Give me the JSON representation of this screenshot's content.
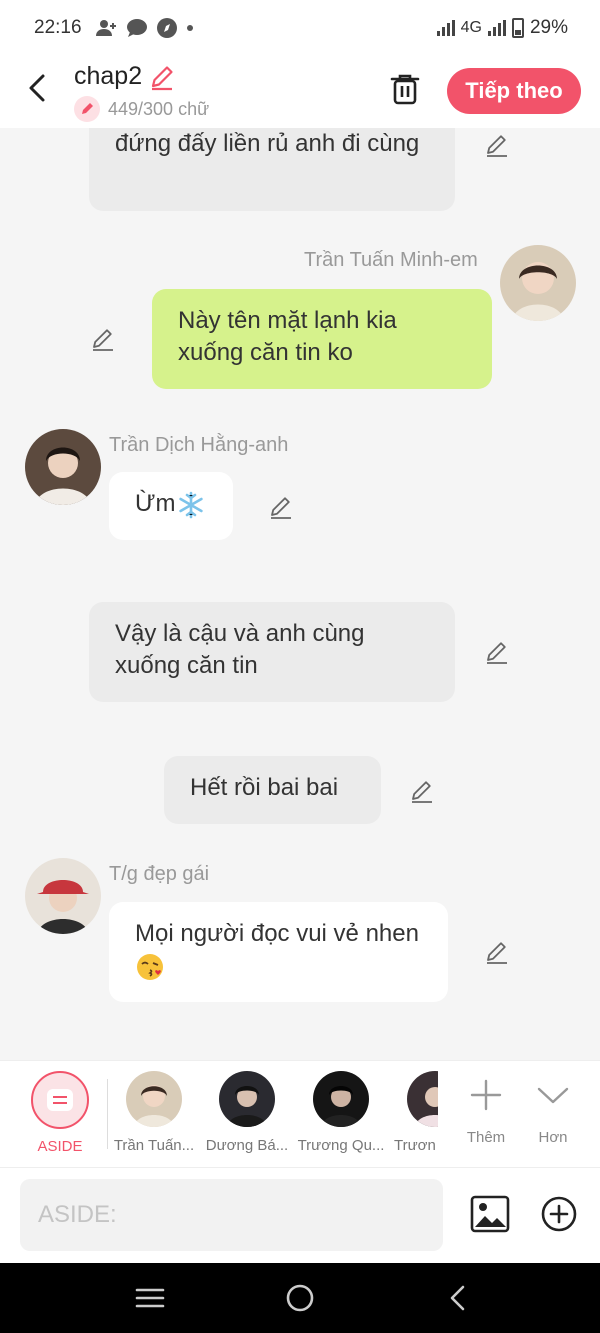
{
  "status": {
    "time": "22:16",
    "network": "4G",
    "battery": "29%"
  },
  "header": {
    "title": "chap2",
    "word_count": "449/300 chữ",
    "next_label": "Tiếp theo"
  },
  "messages": [
    {
      "type": "narration",
      "text": "đứng đấy liền rủ anh đi cùng"
    },
    {
      "type": "right",
      "sender": "Trần Tuấn Minh-em",
      "text": "Này tên mặt lạnh kia xuống căn tin ko"
    },
    {
      "type": "left",
      "sender": "Trần Dịch Hằng-anh",
      "text": "Ừm",
      "emoji": "snowflake"
    },
    {
      "type": "narration",
      "text": "Vậy là cậu và anh cùng xuống căn tin"
    },
    {
      "type": "narration",
      "text": "Hết rồi bai bai"
    },
    {
      "type": "left",
      "sender": "T/g đẹp gái",
      "text": "Mọi người đọc vui vẻ nhen",
      "emoji": "kissing-face"
    }
  ],
  "characters": {
    "aside_label": "ASIDE",
    "items": [
      {
        "name": "Trần Tuấn..."
      },
      {
        "name": "Dương Bá..."
      },
      {
        "name": "Trương Qu..."
      },
      {
        "name": "Trươn"
      }
    ],
    "more_label": "Thêm",
    "expand_label": "Hơn"
  },
  "composer": {
    "placeholder": "ASIDE:"
  },
  "colors": {
    "accent": "#f2536a",
    "bubble_green": "#d6f28c",
    "bubble_grey": "#ebebeb"
  }
}
